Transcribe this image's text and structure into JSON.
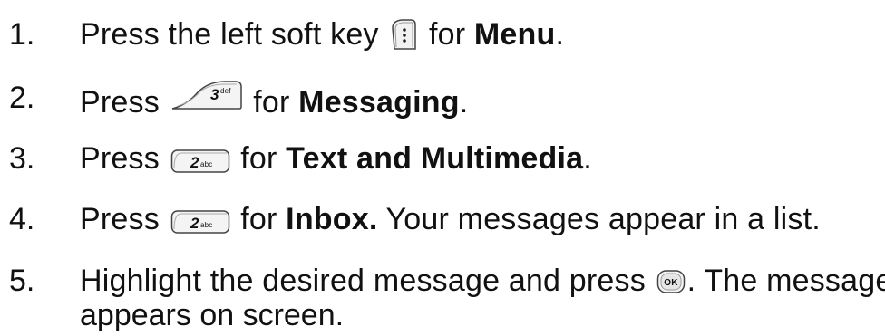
{
  "steps": [
    {
      "number": "1.",
      "before": "Press the left soft key",
      "key_icon": "left-soft-key-menu-icon",
      "middle": "for",
      "bold": "Menu",
      "after": "."
    },
    {
      "number": "2.",
      "before": "Press",
      "key_icon": "key-3-def-icon",
      "key_digit": "3",
      "key_letters": "def",
      "middle": "for",
      "bold": "Messaging",
      "after": "."
    },
    {
      "number": "3.",
      "before": "Press",
      "key_icon": "key-2-abc-icon",
      "key_digit": "2",
      "key_letters": "abc",
      "middle": "for",
      "bold": "Text and Multimedia",
      "after": "."
    },
    {
      "number": "4.",
      "before": "Press",
      "key_icon": "key-2-abc-icon",
      "key_digit": "2",
      "key_letters": "abc",
      "middle": "for",
      "bold": "Inbox.",
      "after": "Your messages appear in a list."
    },
    {
      "number": "5.",
      "before": "Highlight the desired message and press",
      "key_icon": "ok-key-icon",
      "key_label": "OK",
      "after": ". The message",
      "line2": "appears on screen."
    }
  ]
}
